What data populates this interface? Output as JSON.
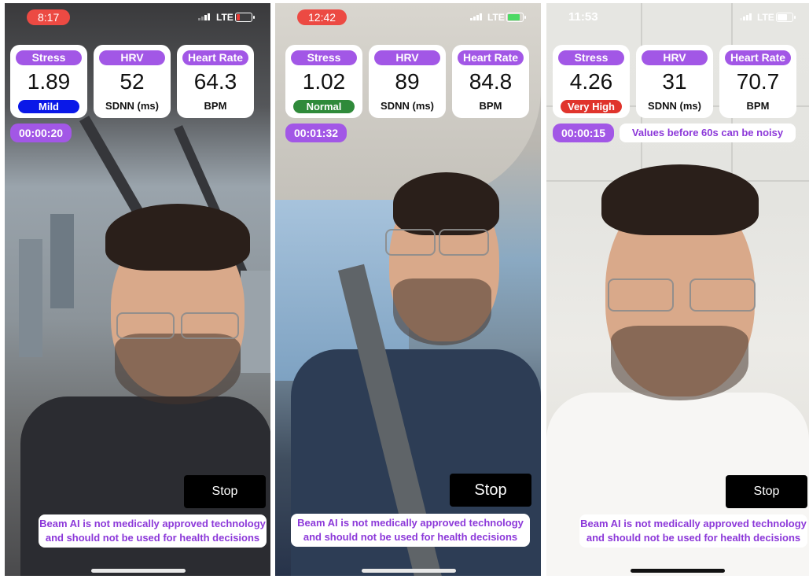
{
  "colors": {
    "accent_purple": "#a257e6",
    "text_purple": "#8c38d9",
    "mild": "#0a18e8",
    "normal": "#2f8a3a",
    "very_high": "#e0342c",
    "time_pill": "#ec4a43"
  },
  "panels": [
    {
      "status": {
        "time": "8:17",
        "network": "LTE"
      },
      "metrics": {
        "stress": {
          "label": "Stress",
          "value": "1.89",
          "level": "Mild"
        },
        "hrv": {
          "label": "HRV",
          "value": "52",
          "unit": "SDNN (ms)"
        },
        "heart_rate": {
          "label": "Heart Rate",
          "value": "64.3",
          "unit": "BPM"
        }
      },
      "timer": "00:00:20",
      "stop_label": "Stop",
      "disclaimer_line1": "Beam AI is not medically approved technology",
      "disclaimer_line2": "and should not be used for health decisions"
    },
    {
      "status": {
        "time": "12:42",
        "network": "LTE"
      },
      "metrics": {
        "stress": {
          "label": "Stress",
          "value": "1.02",
          "level": "Normal"
        },
        "hrv": {
          "label": "HRV",
          "value": "89",
          "unit": "SDNN (ms)"
        },
        "heart_rate": {
          "label": "Heart Rate",
          "value": "84.8",
          "unit": "BPM"
        }
      },
      "timer": "00:01:32",
      "stop_label": "Stop",
      "disclaimer_line1": "Beam AI is not medically approved technology",
      "disclaimer_line2": "and should not be used for health decisions"
    },
    {
      "status": {
        "time": "11:53",
        "network": "LTE"
      },
      "metrics": {
        "stress": {
          "label": "Stress",
          "value": "4.26",
          "level": "Very High"
        },
        "hrv": {
          "label": "HRV",
          "value": "31",
          "unit": "SDNN (ms)"
        },
        "heart_rate": {
          "label": "Heart Rate",
          "value": "70.7",
          "unit": "BPM"
        }
      },
      "timer": "00:00:15",
      "notice": "Values before 60s can be noisy",
      "stop_label": "Stop",
      "disclaimer_line1": "Beam AI is not medically approved technology",
      "disclaimer_line2": "and should not be used for health decisions"
    }
  ]
}
